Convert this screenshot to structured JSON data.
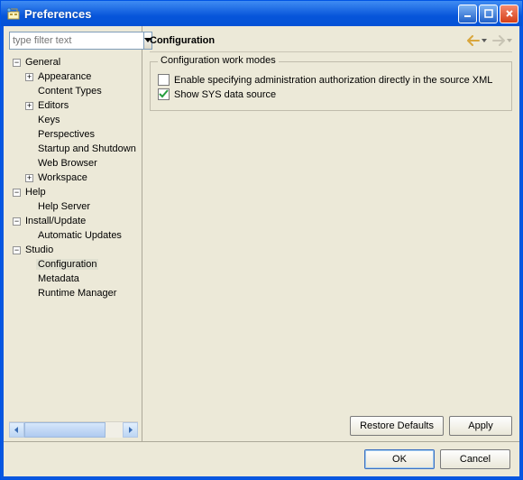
{
  "window": {
    "title": "Preferences"
  },
  "filter": {
    "placeholder": "type filter text"
  },
  "tree": {
    "general": {
      "label": "General",
      "expanded": true
    },
    "appearance": {
      "label": "Appearance"
    },
    "content_types": {
      "label": "Content Types"
    },
    "editors": {
      "label": "Editors"
    },
    "keys": {
      "label": "Keys"
    },
    "perspectives": {
      "label": "Perspectives"
    },
    "startup": {
      "label": "Startup and Shutdown"
    },
    "web_browser": {
      "label": "Web Browser"
    },
    "workspace": {
      "label": "Workspace"
    },
    "help": {
      "label": "Help",
      "expanded": true
    },
    "help_server": {
      "label": "Help Server"
    },
    "install_update": {
      "label": "Install/Update",
      "expanded": true
    },
    "automatic_updates": {
      "label": "Automatic Updates"
    },
    "studio": {
      "label": "Studio",
      "expanded": true
    },
    "configuration": {
      "label": "Configuration"
    },
    "metadata": {
      "label": "Metadata"
    },
    "runtime_manager": {
      "label": "Runtime Manager"
    }
  },
  "page": {
    "title": "Configuration",
    "group_label": "Configuration work modes",
    "option1_label": "Enable specifying administration authorization directly in the source XML",
    "option1_checked": false,
    "option2_label": "Show SYS data source",
    "option2_checked": true
  },
  "buttons": {
    "restore": "Restore Defaults",
    "apply": "Apply",
    "ok": "OK",
    "cancel": "Cancel"
  }
}
